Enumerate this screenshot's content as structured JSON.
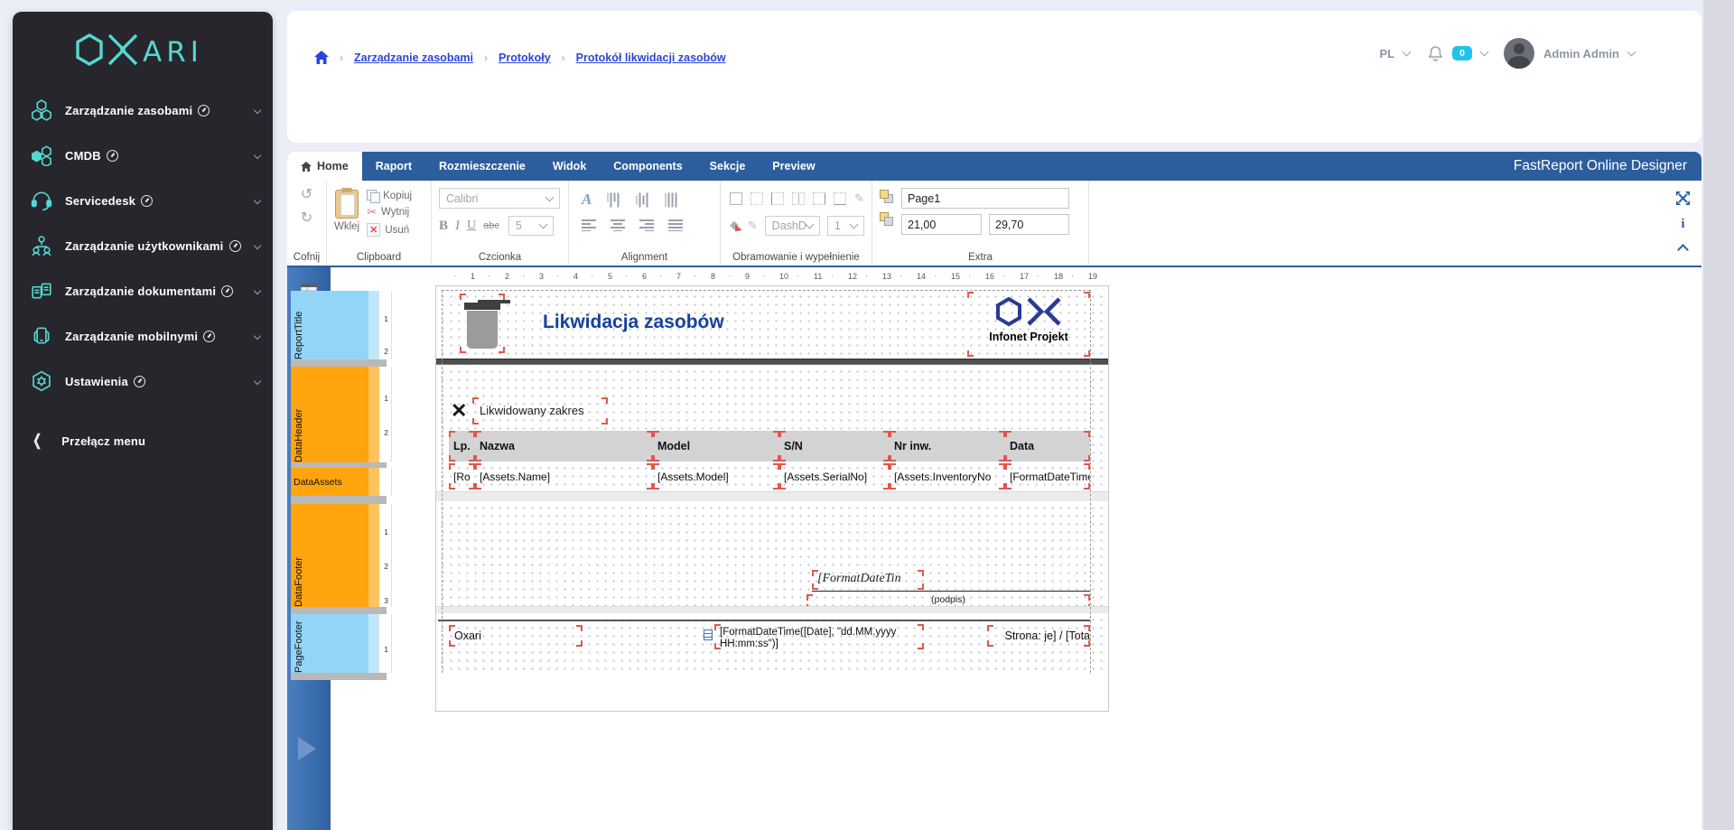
{
  "brand": {
    "name": "OXARI",
    "accent": "#55d7d1"
  },
  "sidebar": {
    "items": [
      {
        "label": "Zarządzanie zasobami"
      },
      {
        "label": "CMDB"
      },
      {
        "label": "Servicedesk"
      },
      {
        "label": "Zarządzanie użytkownikami"
      },
      {
        "label": "Zarządzanie dokumentami"
      },
      {
        "label": "Zarządzanie mobilnymi"
      },
      {
        "label": "Ustawienia"
      }
    ],
    "toggle_label": "Przełącz menu"
  },
  "topbar": {
    "breadcrumb": {
      "item1": "Zarządzanie zasobami",
      "item2": "Protokoły",
      "item3": "Protokół likwidacji zasobów"
    },
    "language": "PL",
    "notification_count": "0",
    "user": "Admin Admin"
  },
  "designer": {
    "title": "FastReport Online Designer",
    "tabs": {
      "home": "Home",
      "raport": "Raport",
      "rozmieszczenie": "Rozmieszczenie",
      "widok": "Widok",
      "components": "Components",
      "sekcje": "Sekcje",
      "preview": "Preview"
    },
    "ribbon": {
      "cofnij_label": "Cofnij",
      "clipboard_label": "Clipboard",
      "wklej": "Wklej",
      "kopiuj": "Kopiuj",
      "wytnij": "Wytnij",
      "usun": "Usuń",
      "czcionka_label": "Czcionka",
      "font_family": "Calibri",
      "font_size": "5",
      "bold": "B",
      "italic": "I",
      "underline": "U",
      "strike": "abc",
      "alignment_label": "Alignment",
      "fontcolor_glyph": "A",
      "border_label": "Obramowanie i wypełnienie",
      "border_style": "DashD",
      "border_width": "1",
      "extra_label": "Extra",
      "page_name": "Page1",
      "page_width": "21,00",
      "page_height": "29,70",
      "undo_glyph": "↺",
      "redo_glyph": "↻",
      "cut_glyph": "✂",
      "delete_glyph": "✕",
      "pencil_glyph": "✎"
    }
  },
  "canvas": {
    "ruler": [
      "1",
      "2",
      "3",
      "4",
      "5",
      "6",
      "7",
      "8",
      "9",
      "10",
      "11",
      "12",
      "13",
      "14",
      "15",
      "16",
      "17",
      "18",
      "19"
    ],
    "bands": {
      "report_title": {
        "name": "ReportTitle",
        "ticks": [
          "1",
          "2"
        ]
      },
      "data_header": {
        "name": "DataHeader",
        "ticks": [
          "1",
          "2"
        ]
      },
      "data_assets": {
        "name": "DataAssets"
      },
      "data_footer": {
        "name": "DataFooter",
        "ticks": [
          "1",
          "2",
          "3"
        ]
      },
      "page_footer": {
        "name": "PageFooter",
        "ticks": [
          "1"
        ]
      }
    },
    "report_title": {
      "title": "Likwidacja zasobów",
      "logo_caption": "Infonet Projekt"
    },
    "data_header": {
      "x_mark": "✕",
      "section_label": "Likwidowany zakres",
      "columns": [
        "Lp.",
        "Nazwa",
        "Model",
        "S/N",
        "Nr inw.",
        "Data"
      ]
    },
    "data_assets": {
      "cells": [
        "[Ro",
        "[Assets.Name]",
        "[Assets.Model]",
        "[Assets.SerialNo]",
        "[Assets.InventoryNo",
        "[FormatDateTime"
      ]
    },
    "data_footer": {
      "date_expr": "[FormatDateTin",
      "signature": "(podpis)"
    },
    "page_footer": {
      "left": "Oxari",
      "center": "[FormatDateTime([Date], \"dd.MM.yyyy HH:mm:ss\")]",
      "right": "Strona: je] / [Tota"
    }
  }
}
